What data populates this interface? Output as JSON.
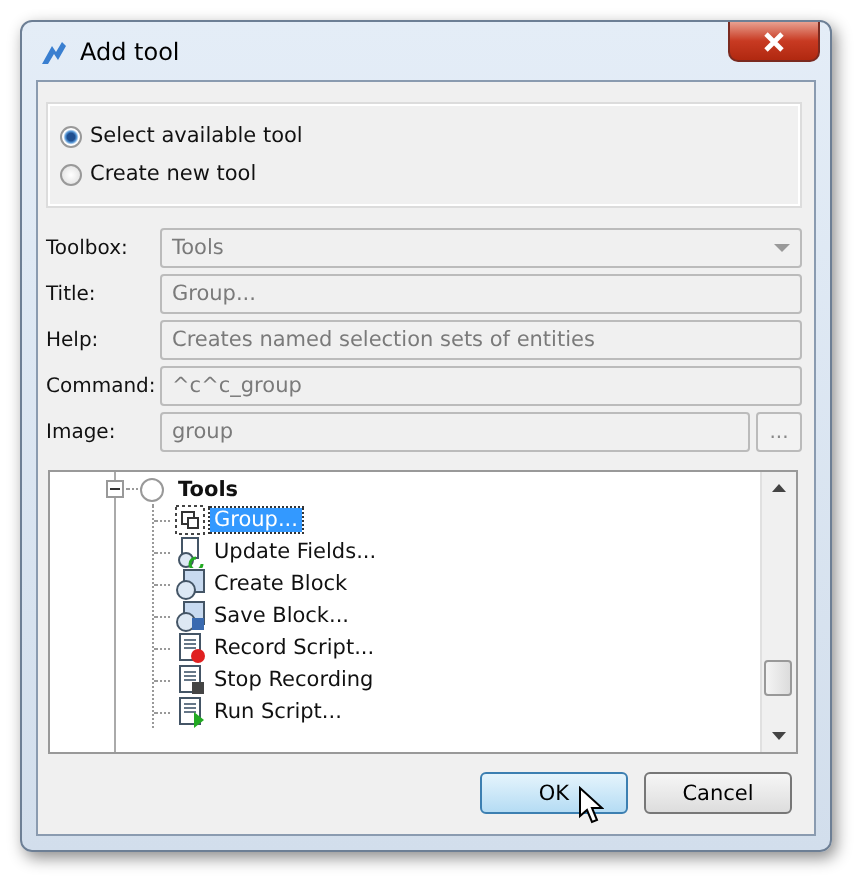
{
  "window": {
    "title": "Add tool"
  },
  "options": [
    {
      "label": "Select available tool",
      "selected": true
    },
    {
      "label": "Create new tool",
      "selected": false
    }
  ],
  "fields": [
    {
      "label": "Toolbox:",
      "value": "Tools",
      "kind": "dropdown",
      "disabled": true
    },
    {
      "label": "Title:",
      "value": "Group...",
      "kind": "text",
      "disabled": true
    },
    {
      "label": "Help:",
      "value": "Creates named selection sets of entities",
      "kind": "text",
      "disabled": true
    },
    {
      "label": "Command:",
      "value": "^c^c_group",
      "kind": "text",
      "disabled": true
    },
    {
      "label": "Image:",
      "value": "group",
      "kind": "browse",
      "button": "...",
      "disabled": true
    }
  ],
  "tree": {
    "label": "Tools",
    "expanded": true,
    "children": [
      {
        "label": "Group...",
        "kind": "group",
        "selected": true
      },
      {
        "label": "Update Fields...",
        "kind": "update",
        "selected": false
      },
      {
        "label": "Create Block",
        "kind": "block",
        "selected": false
      },
      {
        "label": "Save Block...",
        "kind": "save",
        "selected": false
      },
      {
        "label": "Record Script...",
        "kind": "record",
        "selected": false
      },
      {
        "label": "Stop Recording",
        "kind": "stop",
        "selected": false
      },
      {
        "label": "Run Script...",
        "kind": "run",
        "selected": false
      }
    ]
  },
  "buttons": [
    {
      "label": "OK",
      "default": true
    },
    {
      "label": "Cancel",
      "default": false
    }
  ]
}
